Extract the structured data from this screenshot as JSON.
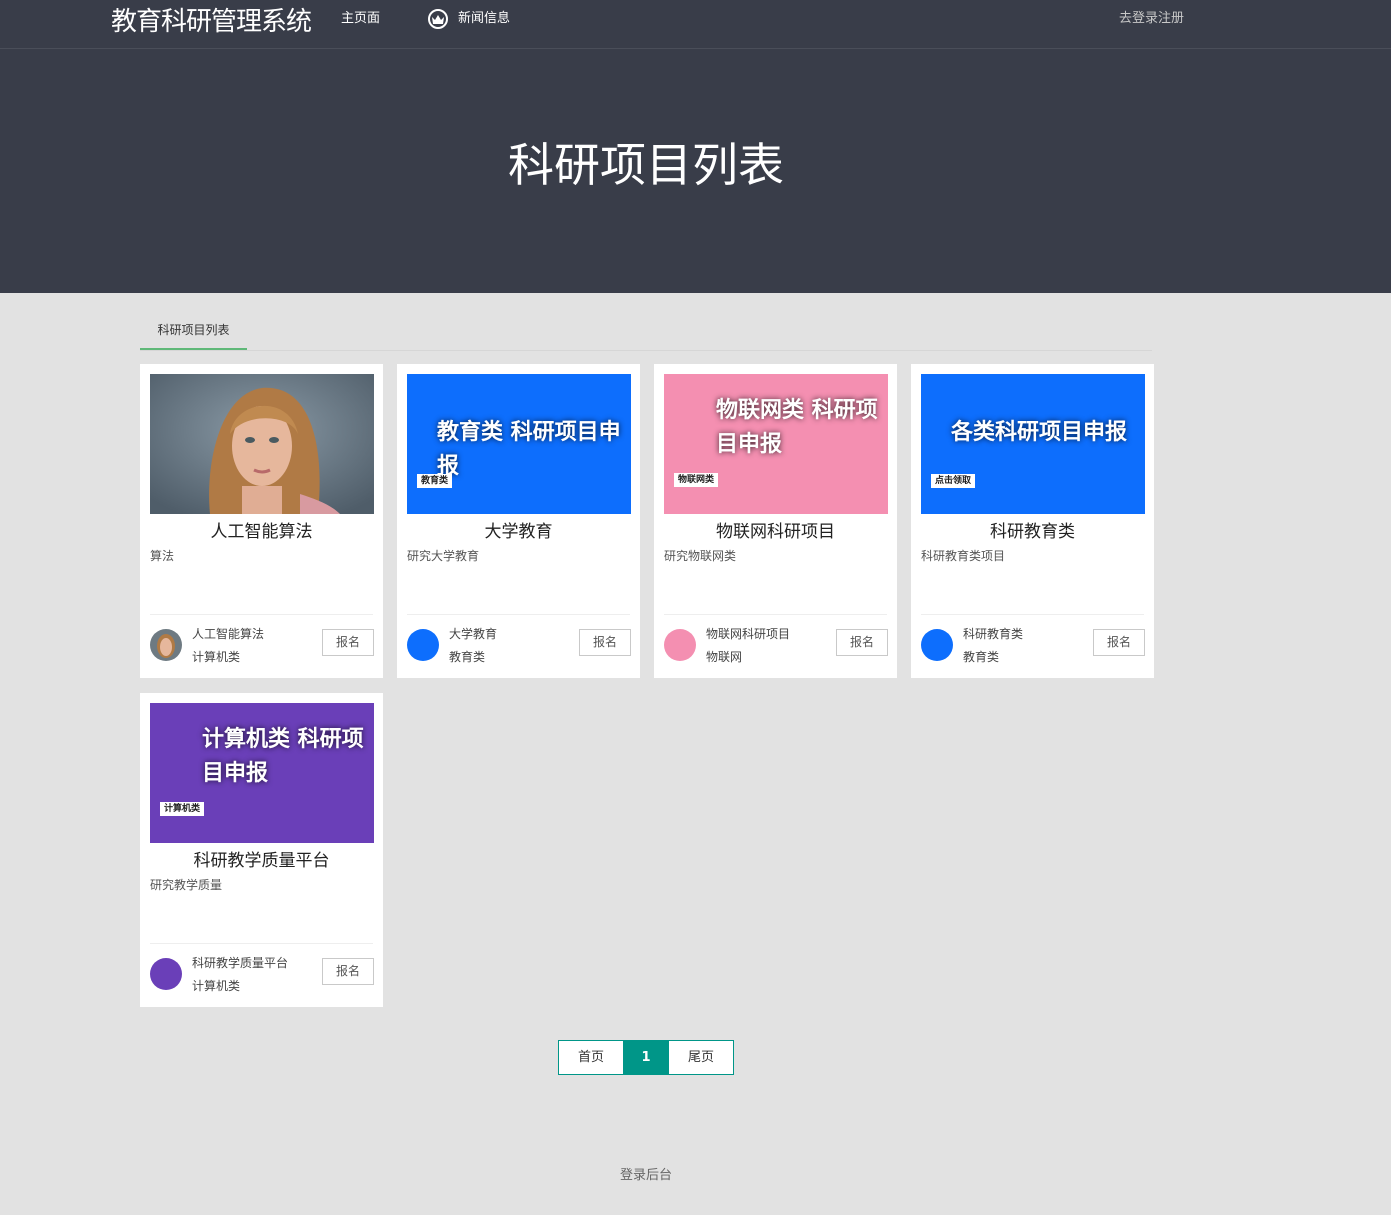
{
  "header": {
    "brand": "教育科研管理系统",
    "nav_home": "主页面",
    "nav_news": "新闻信息",
    "nav_login": "去登录注册"
  },
  "hero": {
    "title": "科研项目列表"
  },
  "tabs": {
    "active": "科研项目列表"
  },
  "cards": [
    {
      "title": "人工智能算法",
      "desc": "算法",
      "meta_name": "人工智能算法",
      "meta_category": "计算机类",
      "button": "报名",
      "image": "portrait-photo"
    },
    {
      "title": "大学教育",
      "desc": "研究大学教育",
      "meta_name": "大学教育",
      "meta_category": "教育类",
      "button": "报名",
      "poster_text": "教育类 科研项目申报",
      "poster_tag": "教育类",
      "poster_color": "#0d6efd"
    },
    {
      "title": "物联网科研项目",
      "desc": "研究物联网类",
      "meta_name": "物联网科研项目",
      "meta_category": "物联网",
      "button": "报名",
      "poster_text_line1": "物联网类 科研项",
      "poster_text_line2": "目申报",
      "poster_tag": "物联网类",
      "poster_color": "#f48fb1"
    },
    {
      "title": "科研教育类",
      "desc": "科研教育类项目",
      "meta_name": "科研教育类",
      "meta_category": "教育类",
      "button": "报名",
      "poster_text": "各类科研项目申报",
      "poster_tag": "点击领取",
      "poster_color": "#0d6efd"
    },
    {
      "title": "科研教学质量平台",
      "desc": "研究教学质量",
      "meta_name": "科研教学质量平台",
      "meta_category": "计算机类",
      "button": "报名",
      "poster_text_line1": "计算机类 科研项",
      "poster_text_line2": "目申报",
      "poster_tag": "计算机类",
      "poster_color": "#6a3fb8"
    }
  ],
  "pager": {
    "first": "首页",
    "current": "1",
    "last": "尾页"
  },
  "footer": {
    "admin_link": "登录后台"
  },
  "colors": {
    "header_bg": "#393d49",
    "accent_green": "#5fb878",
    "pager_teal": "#009688"
  }
}
